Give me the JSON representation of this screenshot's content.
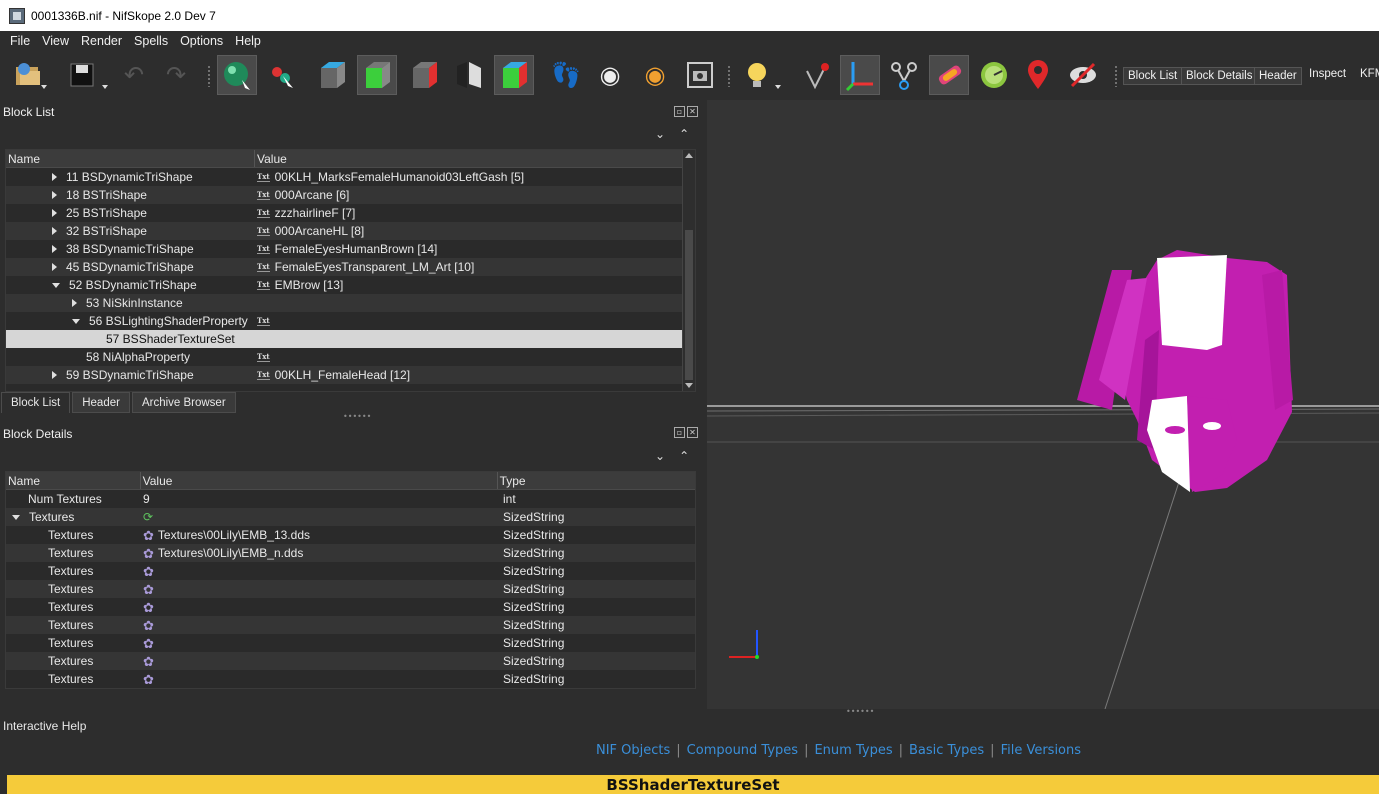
{
  "window": {
    "title": "0001336B.nif - NifSkope 2.0 Dev 7"
  },
  "menu": [
    "File",
    "View",
    "Render",
    "Spells",
    "Options",
    "Help"
  ],
  "toolbar": {
    "text_buttons": [
      "Block List",
      "Block Details",
      "Header"
    ],
    "plain_labels": [
      "Inspect",
      "KFM"
    ]
  },
  "block_list": {
    "title": "Block List",
    "columns": [
      "Name",
      "Value"
    ],
    "rows": [
      {
        "name": "11 BSDynamicTriShape",
        "value": "00KLH_MarksFemaleHumanoid03LeftGash [5]"
      },
      {
        "name": "18 BSTriShape",
        "value": "000Arcane [6]"
      },
      {
        "name": "25 BSTriShape",
        "value": "zzzhairlineF [7]"
      },
      {
        "name": "32 BSTriShape",
        "value": "000ArcaneHL [8]"
      },
      {
        "name": "38 BSDynamicTriShape",
        "value": "FemaleEyesHumanBrown [14]"
      },
      {
        "name": "45 BSDynamicTriShape",
        "value": "FemaleEyesTransparent_LM_Art [10]"
      },
      {
        "name": "52 BSDynamicTriShape",
        "value": "EMBrow [13]"
      },
      {
        "name": "53 NiSkinInstance",
        "value": ""
      },
      {
        "name": "56 BSLightingShaderProperty",
        "value": ""
      },
      {
        "name": "57 BSShaderTextureSet",
        "value": ""
      },
      {
        "name": "58 NiAlphaProperty",
        "value": ""
      },
      {
        "name": "59 BSDynamicTriShape",
        "value": "00KLH_FemaleHead [12]"
      }
    ],
    "txt_badge": "Txt",
    "tabs": [
      "Block List",
      "Header",
      "Archive Browser"
    ]
  },
  "block_details": {
    "title": "Block Details",
    "columns": [
      "Name",
      "Value",
      "Type"
    ],
    "rows": [
      {
        "name": "Num Textures",
        "value": "9",
        "type": "int"
      },
      {
        "name": "Textures",
        "value": "",
        "type": "SizedString"
      },
      {
        "name": "Textures",
        "value": "Textures\\00Lily\\EMB_13.dds",
        "type": "SizedString"
      },
      {
        "name": "Textures",
        "value": "Textures\\00Lily\\EMB_n.dds",
        "type": "SizedString"
      },
      {
        "name": "Textures",
        "value": "",
        "type": "SizedString"
      },
      {
        "name": "Textures",
        "value": "",
        "type": "SizedString"
      },
      {
        "name": "Textures",
        "value": "",
        "type": "SizedString"
      },
      {
        "name": "Textures",
        "value": "",
        "type": "SizedString"
      },
      {
        "name": "Textures",
        "value": "",
        "type": "SizedString"
      },
      {
        "name": "Textures",
        "value": "",
        "type": "SizedString"
      },
      {
        "name": "Textures",
        "value": "",
        "type": "SizedString"
      }
    ]
  },
  "help": {
    "title": "Interactive Help",
    "links": [
      "NIF Objects",
      "Compound Types",
      "Enum Types",
      "Basic Types",
      "File Versions"
    ],
    "banner": "BSShaderTextureSet"
  },
  "colors": {
    "accent_link": "#3a8fd9",
    "banner": "#f5cb3a",
    "model": "#c21fb0",
    "selection": "#d6d6d6"
  }
}
